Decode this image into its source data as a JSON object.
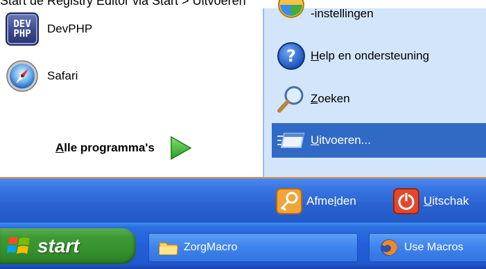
{
  "caption": {
    "text": "Start de Registry Editor via Start > Uitvoeren"
  },
  "left_panel": {
    "items": [
      {
        "label": "DevPHP",
        "icon": "devphp-icon",
        "icon_text_top": "DEV",
        "icon_text_bottom": "PHP"
      },
      {
        "label": "Safari",
        "icon": "safari-icon"
      }
    ],
    "all_programs": {
      "underlined": "A",
      "rest": "lle programma's"
    }
  },
  "right_panel": {
    "top_partial": {
      "label": "-instellingen"
    },
    "items": [
      {
        "underlined": "H",
        "rest": "elp en ondersteuning",
        "icon": "help-icon"
      },
      {
        "underlined": "Z",
        "rest": "oeken",
        "icon": "search-icon"
      },
      {
        "underlined": "U",
        "rest": "itvoeren...",
        "icon": "run-icon",
        "selected": true
      }
    ]
  },
  "bottom_bar": {
    "logoff": {
      "pre": "Afme",
      "underlined": "l",
      "post": "den"
    },
    "shutdown": {
      "underlined": "U",
      "rest": "itschak"
    }
  },
  "taskbar": {
    "start_label": "start",
    "tasks": [
      {
        "label": "ZorgMacro",
        "icon": "folder-icon"
      },
      {
        "label": "Use Macros",
        "icon": "firefox-icon"
      }
    ]
  },
  "colors": {
    "selected": "#316ac5",
    "right_panel_bg": "#d3e5fa",
    "bar_blue": "#2a62d0",
    "start_green": "#3c9a34"
  }
}
